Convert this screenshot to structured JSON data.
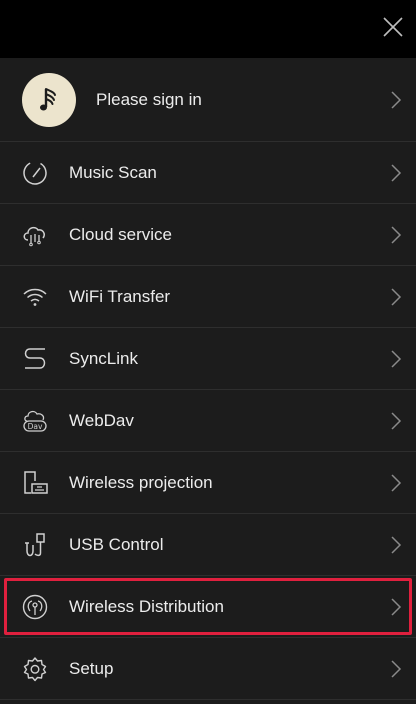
{
  "header": {
    "close_icon": "close-icon"
  },
  "profile": {
    "label": "Please sign in",
    "avatar_icon": "music-note-icon"
  },
  "menu": {
    "items": [
      {
        "label": "Music Scan",
        "icon": "gauge-icon"
      },
      {
        "label": "Cloud service",
        "icon": "cloud-icon"
      },
      {
        "label": "WiFi Transfer",
        "icon": "wifi-icon"
      },
      {
        "label": "SyncLink",
        "icon": "synclink-icon"
      },
      {
        "label": "WebDav",
        "icon": "webdav-icon"
      },
      {
        "label": "Wireless projection",
        "icon": "projection-icon"
      },
      {
        "label": "USB Control",
        "icon": "usb-icon"
      },
      {
        "label": "Wireless Distribution",
        "icon": "broadcast-icon",
        "highlighted": true
      },
      {
        "label": "Setup",
        "icon": "gear-icon"
      }
    ]
  },
  "colors": {
    "background": "#1c1c1c",
    "topbar": "#000000",
    "highlight_border": "#e0203e",
    "avatar_bg": "#ece4cd"
  }
}
